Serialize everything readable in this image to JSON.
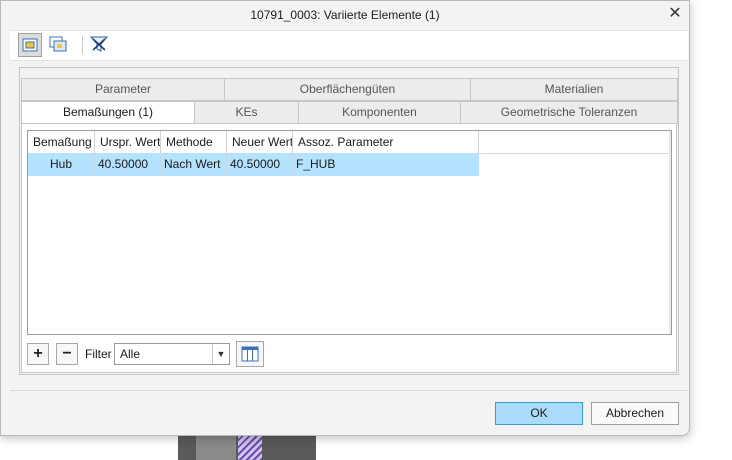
{
  "window": {
    "title": "10791_0003: Variierte Elemente (1)",
    "close_glyph": "✕"
  },
  "toolbar": {
    "buttons": [
      {
        "icon": "show-selected-icon",
        "active": true
      },
      {
        "icon": "show-all-icon",
        "active": false
      },
      {
        "icon": "filter-x-icon",
        "active": false
      }
    ]
  },
  "tabs": {
    "row1": [
      "Parameter",
      "Oberflächengüten",
      "Materialien"
    ],
    "row2": [
      "Bemaßungen (1)",
      "KEs",
      "Komponenten",
      "Geometrische Toleranzen"
    ],
    "selected": "Bemaßungen (1)"
  },
  "table": {
    "columns": [
      "Bemaßung",
      "Urspr. Wert",
      "Methode",
      "Neuer Wert",
      "Assoz. Parameter"
    ],
    "rows": [
      {
        "bemassung": "Hub",
        "urspr_wert": "40.50000",
        "methode": "Nach Wert",
        "neuer_wert": "40.50000",
        "assoz_parameter": "F_HUB",
        "selected": true
      }
    ]
  },
  "bottom": {
    "add_glyph": "+",
    "remove_glyph": "−",
    "filter_label": "Filter",
    "filter_value": "Alle",
    "dropdown_glyph": "▼"
  },
  "footer": {
    "ok_label": "OK",
    "cancel_label": "Abbrechen"
  },
  "colors": {
    "accent": "#3f9ad8",
    "selection": "#b4e2ff",
    "ok_fill": "#a9dcfb"
  }
}
